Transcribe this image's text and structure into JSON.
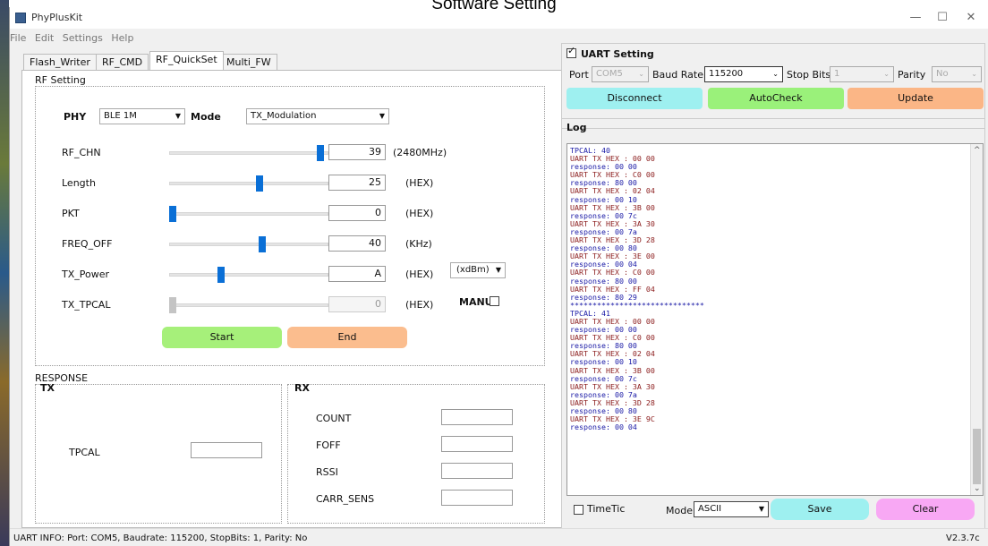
{
  "caption": "Software Setting",
  "window": {
    "title": "PhyPlusKit",
    "controls": [
      "—",
      "☐",
      "✕"
    ]
  },
  "menu": [
    "File",
    "Edit",
    "Settings",
    "Help"
  ],
  "tabs": [
    "Flash_Writer",
    "RF_CMD",
    "RF_QuickSet",
    "Multi_FW"
  ],
  "selected_tab": "RF_QuickSet",
  "rf_setting": {
    "group_label": "RF Setting",
    "phy_label": "PHY",
    "phy_value": "BLE 1M",
    "mode_label": "Mode",
    "mode_value": "TX_Modulation",
    "rows": [
      {
        "label": "RF_CHN",
        "value": "39",
        "unit": "(2480MHz)",
        "level": 0.97,
        "enabled": true
      },
      {
        "label": "Length",
        "value": "25",
        "unit": "(HEX)",
        "level": 0.57,
        "enabled": true
      },
      {
        "label": "PKT",
        "value": "0",
        "unit": "(HEX)",
        "level": 0.0,
        "enabled": true
      },
      {
        "label": "FREQ_OFF",
        "value": "40",
        "unit": "(KHz)",
        "level": 0.59,
        "enabled": true
      },
      {
        "label": "TX_Power",
        "value": "A",
        "unit": "(HEX)",
        "level": 0.32,
        "enabled": true
      },
      {
        "label": "TX_TPCAL",
        "value": "0",
        "unit": "(HEX)",
        "level": 0.0,
        "enabled": false
      }
    ],
    "tx_power_unit": "(xdBm)",
    "manu_label": "MANU",
    "start_label": "Start",
    "end_label": "End"
  },
  "response": {
    "group_label": "RESPONSE",
    "tx_label": "TX",
    "rx_label": "RX",
    "tpcal_label": "TPCAL",
    "rx_fields": [
      "COUNT",
      "FOFF",
      "RSSI",
      "CARR_SENS"
    ]
  },
  "uart": {
    "title": "UART Setting",
    "checked": true,
    "port_label": "Port",
    "port_value": "COM5",
    "baud_label": "Baud Rate",
    "baud_value": "115200",
    "stop_label": "Stop Bits",
    "stop_value": "1",
    "parity_label": "Parity",
    "parity_value": "No",
    "disconnect_label": "Disconnect",
    "autocheck_label": "AutoCheck",
    "update_label": "Update"
  },
  "log": {
    "label": "Log",
    "lines": [
      "TPCAL: 40",
      "UART TX HEX : 00 00",
      "response: 00 00",
      "UART TX HEX : C0 00",
      "response: 80 00",
      "UART TX HEX : 02 04",
      "response: 00 10",
      "UART TX HEX : 3B 00",
      "response: 00 7c",
      "UART TX HEX : 3A 30",
      "response: 00 7a",
      "UART TX HEX : 3D 28",
      "response: 00 80",
      "UART TX HEX : 3E 00",
      "response: 00 04",
      "UART TX HEX : C0 00",
      "response: 80 00",
      "UART TX HEX : FF 04",
      "response: 80 29",
      "******************************",
      "TPCAL: 41",
      "UART TX HEX : 00 00",
      "response: 00 00",
      "UART TX HEX : C0 00",
      "response: 80 00",
      "UART TX HEX : 02 04",
      "response: 00 10",
      "UART TX HEX : 3B 00",
      "response: 00 7c",
      "UART TX HEX : 3A 30",
      "response: 00 7a",
      "UART TX HEX : 3D 28",
      "response: 00 80",
      "UART TX HEX : 3E 9C",
      "response: 00 04"
    ],
    "timetic_label": "TimeTic",
    "mode_label": "Mode",
    "mode_value": "ASCII",
    "save_label": "Save",
    "clear_label": "Clear"
  },
  "status": {
    "info": "UART INFO: Port: COM5, Baudrate: 115200, StopBits: 1, Parity: No",
    "version": "V2.3.7c"
  },
  "colors": {
    "disconnect": "#9ef0f0",
    "autocheck": "#9af17a",
    "update": "#fbb686",
    "start": "#a6f07a",
    "end": "#fbbd8e",
    "save": "#9ef0f0",
    "clear": "#f8a8f4",
    "slider_thumb": "#0a6fd6"
  }
}
